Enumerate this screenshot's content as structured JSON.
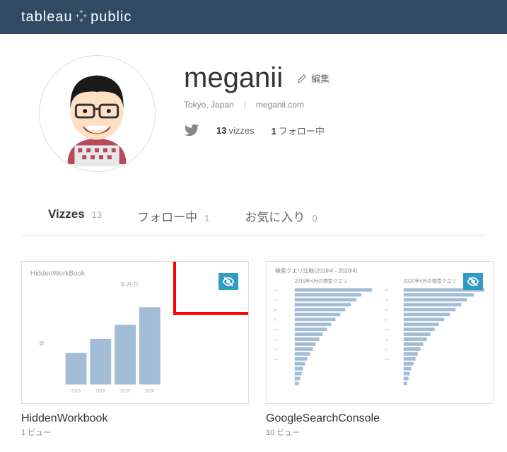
{
  "header": {
    "logo_left": "tableau",
    "logo_right": "public"
  },
  "profile": {
    "name": "meganii",
    "edit_label": "編集",
    "location": "Tokyo, Japan",
    "website": "meganii.com",
    "vizzes_count": "13",
    "vizzes_label": "vizzes",
    "following_count": "1",
    "following_label": "フォロー中"
  },
  "tabs": {
    "vizzes": {
      "label": "Vizzes",
      "count": "13"
    },
    "following": {
      "label": "フォロー中",
      "count": "1"
    },
    "favorites": {
      "label": "お気に入り",
      "count": "0"
    }
  },
  "cards": [
    {
      "title": "HiddenWorkbook",
      "views": "1 ビュー"
    },
    {
      "title": "GoogleSearchConsole",
      "views": "10 ビュー"
    }
  ],
  "thumb1": {
    "title": "HiddenWorkBook",
    "subtitle": "年-月-日"
  },
  "thumb2": {
    "title": "検索クエリ比較(2019/4 - 2020/4)",
    "left_label": "2019年4月の検索クエリ",
    "right_label": "2020年4月の検索クエリ"
  }
}
